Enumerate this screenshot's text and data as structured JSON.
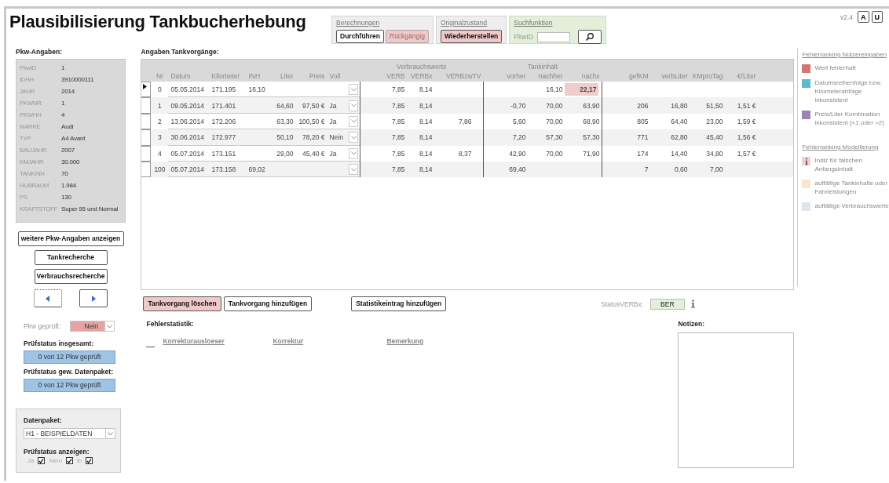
{
  "title": "Plausibilisierung Tankbucherhebung",
  "version": "v2.4",
  "corner_buttons": [
    "A",
    "U"
  ],
  "calc_groups": [
    {
      "kind": "buttons",
      "title": "Berechnungen",
      "buttons": [
        {
          "label": "Durchführen",
          "kind": "plain",
          "disabled": false
        },
        {
          "label": "Rückgängig",
          "kind": "alert",
          "disabled": true
        }
      ]
    },
    {
      "kind": "buttons",
      "title": "Originalzustand",
      "buttons": [
        {
          "label": "Wiederherstellen",
          "kind": "alert",
          "disabled": false
        }
      ]
    },
    {
      "kind": "search",
      "title": "Suchfunktion",
      "field_label": "PkwID"
    }
  ],
  "vehicle": {
    "heading": "Pkw-Angaben:",
    "fields": [
      {
        "label": "PkwID",
        "value": "1"
      },
      {
        "label": "IDHH",
        "value": "3910000111"
      },
      {
        "label": "JAHR",
        "value": "2014"
      },
      {
        "label": "PKWNR",
        "value": "1"
      },
      {
        "label": "PKWHH",
        "value": "4"
      },
      {
        "label": "MARKE",
        "value": "Audi"
      },
      {
        "label": "TYP",
        "value": "A4 Avant"
      },
      {
        "label": "BAUJAHR",
        "value": "2007"
      },
      {
        "label": "KMJAHR",
        "value": "30.000"
      },
      {
        "label": "TANKINH",
        "value": "70"
      },
      {
        "label": "HUBRAUM",
        "value": "1.984"
      },
      {
        "label": "PS",
        "value": "130"
      },
      {
        "label": "KRAFTSTOFF",
        "value": "Super 95 und Normal"
      }
    ]
  },
  "vehicle_buttons": [
    "weitere Pkw-Angaben anzeigen",
    "Tankrecherche",
    "Verbrauchsrecherche"
  ],
  "checked_field": {
    "label": "Pkw geprüft:",
    "value": "Nein"
  },
  "status_total": {
    "label": "Prüfstatus insgesamt:",
    "value": "0 von 12 Pkw geprüft"
  },
  "status_package": {
    "label": "Prüfstatus gew. Datenpaket:",
    "value": "0 von 12 Pkw geprüft"
  },
  "package": {
    "label": "Datenpaket:",
    "value": "H1 - BEISPIELDATEN",
    "filter_label": "Prüfstatus anzeigen:",
    "filters": [
      {
        "label": "Ja",
        "checked": true
      },
      {
        "label": "Nein",
        "checked": true
      },
      {
        "label": "ib",
        "checked": true
      }
    ]
  },
  "table": {
    "heading": "Angaben Tankvorgänge:",
    "groups": [
      "Verbrauchswerte",
      "Tankinhalt"
    ],
    "columns": [
      "Nr",
      "Datum",
      "Kilometer",
      "INH",
      "Liter",
      "Preis",
      "Voll",
      "VERB",
      "VERBx",
      "VERBzwTV",
      "vorher",
      "nachher",
      "nachx",
      "gefKM",
      "verbLiter",
      "KMproTag",
      "€/Liter"
    ],
    "rows": [
      {
        "current": true,
        "nachx_error": true,
        "cells": [
          "0",
          "05.05.2014",
          "171.195",
          "16,10",
          null,
          null,
          null,
          "7,85",
          "8,14",
          null,
          null,
          "16,10",
          "22,17",
          null,
          null,
          null,
          null
        ]
      },
      {
        "current": false,
        "nachx_error": false,
        "cells": [
          "1",
          "09.05.2014",
          "171.401",
          null,
          "64,60",
          "97,50 €",
          "Ja",
          "7,85",
          "8,14",
          null,
          "-0,70",
          "70,00",
          "63,90",
          "206",
          "16,80",
          "51,50",
          "1,51 €"
        ]
      },
      {
        "current": false,
        "nachx_error": false,
        "cells": [
          "2",
          "13.06.2014",
          "172.206",
          null,
          "63,30",
          "100,50 €",
          "Ja",
          "7,85",
          "8,14",
          "7,86",
          "5,60",
          "70,00",
          "68,90",
          "805",
          "64,40",
          "23,00",
          "1,59 €"
        ]
      },
      {
        "current": false,
        "nachx_error": false,
        "cells": [
          "3",
          "30.06.2014",
          "172.977",
          null,
          "50,10",
          "78,20 €",
          "Nein",
          "7,85",
          "8,14",
          null,
          "7,20",
          "57,30",
          "57,30",
          "771",
          "62,80",
          "45,40",
          "1,56 €"
        ]
      },
      {
        "current": false,
        "nachx_error": false,
        "cells": [
          "4",
          "05.07.2014",
          "173.151",
          null,
          "29,00",
          "45,40 €",
          "Ja",
          "7,85",
          "8,14",
          "8,37",
          "42,90",
          "70,00",
          "71,90",
          "174",
          "14,40",
          "34,80",
          "1,57 €"
        ]
      },
      {
        "current": false,
        "nachx_error": false,
        "cells": [
          "100",
          "05.07.2014",
          "173.158",
          "69,02",
          null,
          null,
          null,
          "7,85",
          "8,14",
          null,
          "69,40",
          null,
          null,
          "7",
          "0,60",
          "7,00",
          null
        ]
      }
    ]
  },
  "table_buttons": [
    {
      "label": "Tankvorgang löschen",
      "kind": "alert"
    },
    {
      "label": "Tankvorgang hinzufügen",
      "kind": "plain"
    },
    {
      "label": "Statistikeintrag hinzufügen",
      "kind": "plain"
    }
  ],
  "status_verbx": {
    "label": "StatusVERBx:",
    "value": "BER"
  },
  "error_stats": {
    "heading": "Fehlerstatistik:",
    "columns": [
      "Korrekturausloeser",
      "Korrektur",
      "Bemerkung"
    ]
  },
  "notes": {
    "label": "Notizen:"
  },
  "legend": [
    {
      "title": "Fehlerranking Nutzereingaben",
      "items": [
        {
          "kind": "swatch",
          "color": "#d27574",
          "label": "Wert fehlerhaft"
        },
        {
          "kind": "swatch",
          "color": "#5bbccc",
          "label": "Datumsreihenfolge bzw. Kilometerabfolge inkonsistent"
        },
        {
          "kind": "swatch",
          "color": "#9b84b8",
          "label": "Preis/Liter Kombination inkonsistent (<1 oder >2)"
        }
      ]
    },
    {
      "title": "Fehlerranking Modellierung",
      "items": [
        {
          "kind": "info",
          "label": "Indiz für falschen Anfangsinhalt"
        },
        {
          "kind": "swatch",
          "color": "#fce4d2",
          "label": "auffällige Tankinhalte oder Fahrleistungen"
        },
        {
          "kind": "swatch",
          "color": "#dfe5ee",
          "label": "auffällige Verbrauchswerte"
        }
      ]
    }
  ]
}
